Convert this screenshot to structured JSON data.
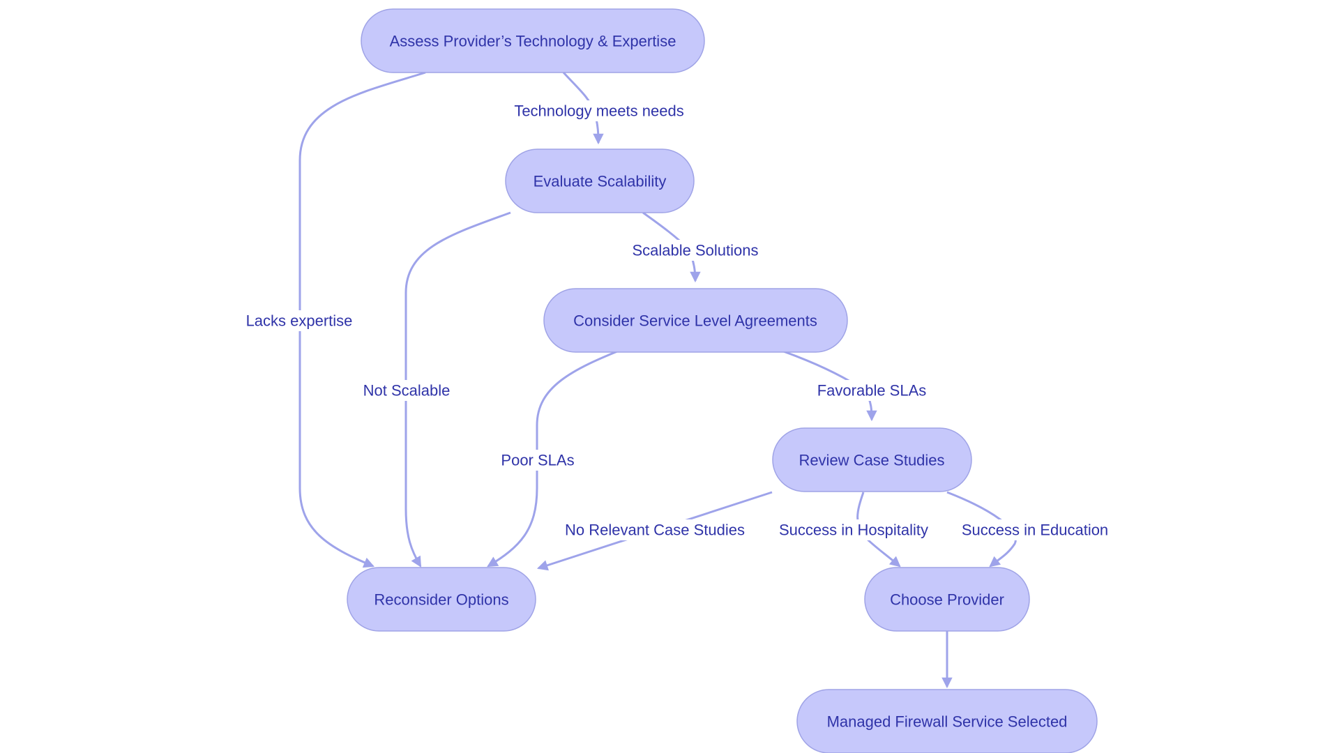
{
  "diagram": {
    "type": "flowchart",
    "colors": {
      "node_fill": "#c6c8fb",
      "node_stroke": "#9fa3e6",
      "edge": "#9ea3ea",
      "text": "#2f33a8",
      "background": "#ffffff"
    },
    "nodes": [
      {
        "id": "assess",
        "label": "Assess Provider’s Technology & Expertise"
      },
      {
        "id": "scalability",
        "label": "Evaluate Scalability"
      },
      {
        "id": "sla",
        "label": "Consider Service Level Agreements"
      },
      {
        "id": "cases",
        "label": "Review Case Studies"
      },
      {
        "id": "reconsider",
        "label": "Reconsider Options"
      },
      {
        "id": "choose",
        "label": "Choose Provider"
      },
      {
        "id": "selected",
        "label": "Managed Firewall Service Selected"
      }
    ],
    "edges": [
      {
        "from": "assess",
        "to": "scalability",
        "label": "Technology meets needs"
      },
      {
        "from": "assess",
        "to": "reconsider",
        "label": "Lacks expertise"
      },
      {
        "from": "scalability",
        "to": "sla",
        "label": "Scalable Solutions"
      },
      {
        "from": "scalability",
        "to": "reconsider",
        "label": "Not Scalable"
      },
      {
        "from": "sla",
        "to": "cases",
        "label": "Favorable SLAs"
      },
      {
        "from": "sla",
        "to": "reconsider",
        "label": "Poor SLAs"
      },
      {
        "from": "cases",
        "to": "reconsider",
        "label": "No Relevant Case Studies"
      },
      {
        "from": "cases",
        "to": "choose",
        "label": "Success in Hospitality"
      },
      {
        "from": "cases",
        "to": "choose",
        "label": "Success in Education"
      },
      {
        "from": "choose",
        "to": "selected",
        "label": ""
      }
    ]
  }
}
